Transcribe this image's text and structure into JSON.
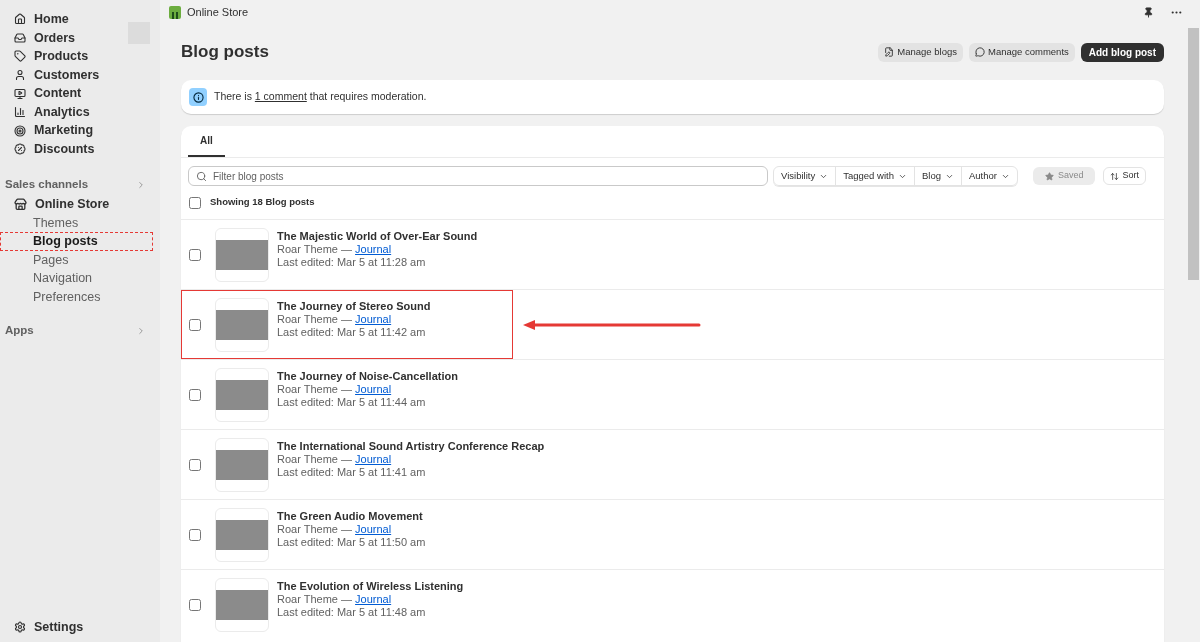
{
  "sidebar": {
    "items": [
      {
        "label": "Home"
      },
      {
        "label": "Orders"
      },
      {
        "label": "Products"
      },
      {
        "label": "Customers"
      },
      {
        "label": "Content"
      },
      {
        "label": "Analytics"
      },
      {
        "label": "Marketing"
      },
      {
        "label": "Discounts"
      }
    ],
    "sales_channels": {
      "label": "Sales channels",
      "channel": "Online Store",
      "children": [
        {
          "label": "Themes",
          "selected": false,
          "annotated": false
        },
        {
          "label": "Blog posts",
          "selected": true,
          "annotated": true
        },
        {
          "label": "Pages",
          "selected": false,
          "annotated": false
        },
        {
          "label": "Navigation",
          "selected": false,
          "annotated": false
        },
        {
          "label": "Preferences",
          "selected": false,
          "annotated": false
        }
      ]
    },
    "apps": {
      "label": "Apps"
    },
    "settings": {
      "label": "Settings"
    }
  },
  "topbar": {
    "title": "Online Store"
  },
  "page": {
    "title": "Blog posts",
    "actions": [
      {
        "label": "Manage blogs",
        "kind": "secondary"
      },
      {
        "label": "Manage comments",
        "kind": "secondary"
      },
      {
        "label": "Add blog post",
        "kind": "primary"
      }
    ]
  },
  "banner": {
    "text": "There is ",
    "link": "1 comment",
    "after": " that requires moderation."
  },
  "tabs": [
    {
      "label": "All",
      "selected": true
    }
  ],
  "filter": {
    "placeholder": "Filter blog posts",
    "dropdowns": [
      "Visibility",
      "Tagged with",
      "Blog",
      "Author"
    ],
    "saved": {
      "label": "Saved",
      "disabled": true
    },
    "sort": "Sort"
  },
  "list": {
    "summary": "Showing 18 Blog posts",
    "all_checked": false,
    "rows": [
      {
        "title": "The Majestic World of Over-Ear Sound",
        "theme": "Roar Theme —",
        "blog": "Journal",
        "edited": "Last edited: Mar 5 at 11:28 am",
        "checked": false,
        "annotated": false
      },
      {
        "title": "The Journey of Stereo Sound",
        "theme": "Roar Theme —",
        "blog": "Journal",
        "edited": "Last edited: Mar 5 at 11:42 am",
        "checked": false,
        "annotated": true
      },
      {
        "title": "The Journey of Noise-Cancellation",
        "theme": "Roar Theme —",
        "blog": "Journal",
        "edited": "Last edited: Mar 5 at 11:44 am",
        "checked": false,
        "annotated": false
      },
      {
        "title": "The International Sound Artistry Conference Recap",
        "theme": "Roar Theme —",
        "blog": "Journal",
        "edited": "Last edited: Mar 5 at 11:41 am",
        "checked": false,
        "annotated": false
      },
      {
        "title": "The Green Audio Movement",
        "theme": "Roar Theme —",
        "blog": "Journal",
        "edited": "Last edited: Mar 5 at 11:50 am",
        "checked": false,
        "annotated": false
      },
      {
        "title": "The Evolution of Wireless Listening",
        "theme": "Roar Theme —",
        "blog": "Journal",
        "edited": "Last edited: Mar 5 at 11:48 am",
        "checked": false,
        "annotated": false
      }
    ]
  }
}
